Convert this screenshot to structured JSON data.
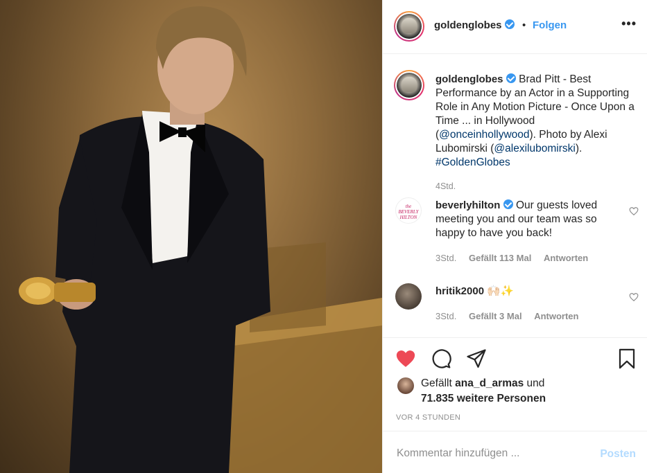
{
  "post": {
    "username": "goldenglobes",
    "follow_label": "Folgen",
    "separator": "•",
    "more_label": "•••"
  },
  "caption": {
    "username": "goldenglobes",
    "text_1": "Brad Pitt - Best Performance by an Actor in a Supporting Role in Any Motion Picture - Once Upon a Time ... in Hollywood (",
    "mention_1": "@onceinhollywood",
    "text_2": "). Photo by Alexi Lubomirski (",
    "mention_2": "@alexilubomirski",
    "text_3": ").",
    "hashtag": "#GoldenGlobes",
    "time": "4Std."
  },
  "comments": [
    {
      "avatar_text": "the BEVERLY HILTON",
      "username": "beverlyhilton",
      "verified": true,
      "text": "Our guests loved meeting you and our team was so happy to have you back!",
      "time": "3Std.",
      "likes": "Gefällt 113 Mal",
      "reply": "Antworten"
    },
    {
      "username": "hritik2000",
      "verified": false,
      "text": "🙌🏻✨",
      "time": "3Std.",
      "likes": "Gefällt 3 Mal",
      "reply": "Antworten"
    }
  ],
  "likes": {
    "prefix": "Gefällt",
    "user": "ana_d_armas",
    "mid": "und",
    "count": "71.835 weitere Personen"
  },
  "timestamp": "VOR 4 STUNDEN",
  "add_comment": {
    "placeholder": "Kommentar hinzufügen ...",
    "post_label": "Posten"
  },
  "icons": {
    "like": "heart-icon",
    "comment": "comment-icon",
    "share": "share-icon",
    "save": "bookmark-icon"
  },
  "colors": {
    "accent": "#3897f0",
    "like": "#ed4956",
    "link": "#00376b",
    "muted": "#8e8e8e"
  }
}
